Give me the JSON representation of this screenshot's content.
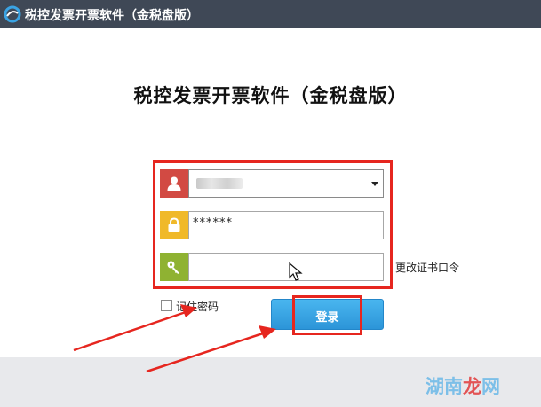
{
  "window": {
    "title": "税控发票开票软件（金税盘版）",
    "logo_icon": "swirl-logo-icon"
  },
  "main": {
    "title": "税控发票开票软件（金税盘版）"
  },
  "form": {
    "username": {
      "icon": "user-icon",
      "value": "",
      "control": "dropdown"
    },
    "password": {
      "icon": "lock-icon",
      "value": "******"
    },
    "certificate_password": {
      "icon": "key-icon",
      "value": ""
    },
    "change_cert_password_label": "更改证书口令",
    "remember_password_label": "记住密码",
    "remember_password_checked": false,
    "login_label": "登录"
  },
  "colors": {
    "titlebar": "#3f4856",
    "user_icon_bg": "#d24a43",
    "lock_icon_bg": "#f0b929",
    "key_icon_bg": "#8fb232",
    "login_button": "#2c95d8",
    "annotation_red": "#e6261f",
    "bottom_bar": "#e8e9ec"
  },
  "watermark": {
    "part1": "湖南",
    "part2": "龙",
    "part3": "网"
  }
}
